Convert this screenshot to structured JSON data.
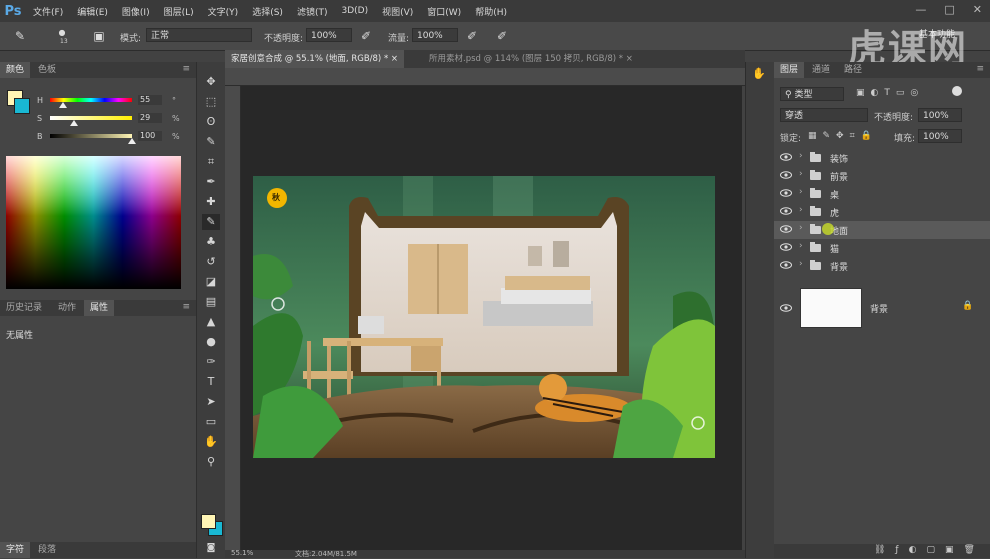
{
  "app": {
    "logo": "Ps"
  },
  "menu": [
    "文件(F)",
    "编辑(E)",
    "图像(I)",
    "图层(L)",
    "文字(Y)",
    "选择(S)",
    "滤镜(T)",
    "3D(D)",
    "视图(V)",
    "窗口(W)",
    "帮助(H)"
  ],
  "options": {
    "brush_size": "13",
    "mode_label": "模式:",
    "mode_value": "正常",
    "opacity_label": "不透明度:",
    "opacity_value": "100%",
    "flow_label": "流量:",
    "flow_value": "100%",
    "workspace": "基本功能"
  },
  "watermark": "虎课网",
  "color_panel": {
    "tabs": [
      "颜色",
      "色板"
    ],
    "h_label": "H",
    "h_value": "55",
    "h_unit": "°",
    "s_label": "S",
    "s_value": "29",
    "s_unit": "%",
    "b_label": "B",
    "b_value": "100",
    "b_unit": "%",
    "h_level": 55,
    "s_level": 29,
    "b_level": 100,
    "foreground_color": "#fff5b5",
    "background_color": "#19b8d3"
  },
  "properties_panel": {
    "tabs": [
      "历史记录",
      "动作",
      "属性"
    ],
    "content": "无属性"
  },
  "document_tabs": [
    {
      "label": "家居创意合成 @ 55.1% (地面, RGB/8) *",
      "active": true
    },
    {
      "label": "所用素材.psd @ 114% (图层 150 拷贝, RGB/8) *",
      "active": false
    }
  ],
  "status": {
    "zoom": "55.1%",
    "doc": "文档:2.04M/81.5M"
  },
  "bottom_tabs": [
    "字符",
    "段落"
  ],
  "layers_panel": {
    "tabs": [
      "图层",
      "通道",
      "路径"
    ],
    "filter_label": "类型",
    "blend_mode": "穿透",
    "opacity_label": "不透明度:",
    "opacity_value": "100%",
    "lock_label": "锁定:",
    "fill_label": "填充:",
    "fill_value": "100%",
    "layers": [
      {
        "name": "装饰",
        "type": "group",
        "selected": false
      },
      {
        "name": "前景",
        "type": "group",
        "selected": false
      },
      {
        "name": "桌",
        "type": "group",
        "selected": false
      },
      {
        "name": "虎",
        "type": "group",
        "selected": false
      },
      {
        "name": "地面",
        "type": "group",
        "selected": true
      },
      {
        "name": "猫",
        "type": "group",
        "selected": false
      },
      {
        "name": "背景",
        "type": "group",
        "selected": false
      }
    ],
    "background_layer": {
      "name": "背景",
      "locked": true
    }
  },
  "art": {
    "badge": "秋"
  }
}
